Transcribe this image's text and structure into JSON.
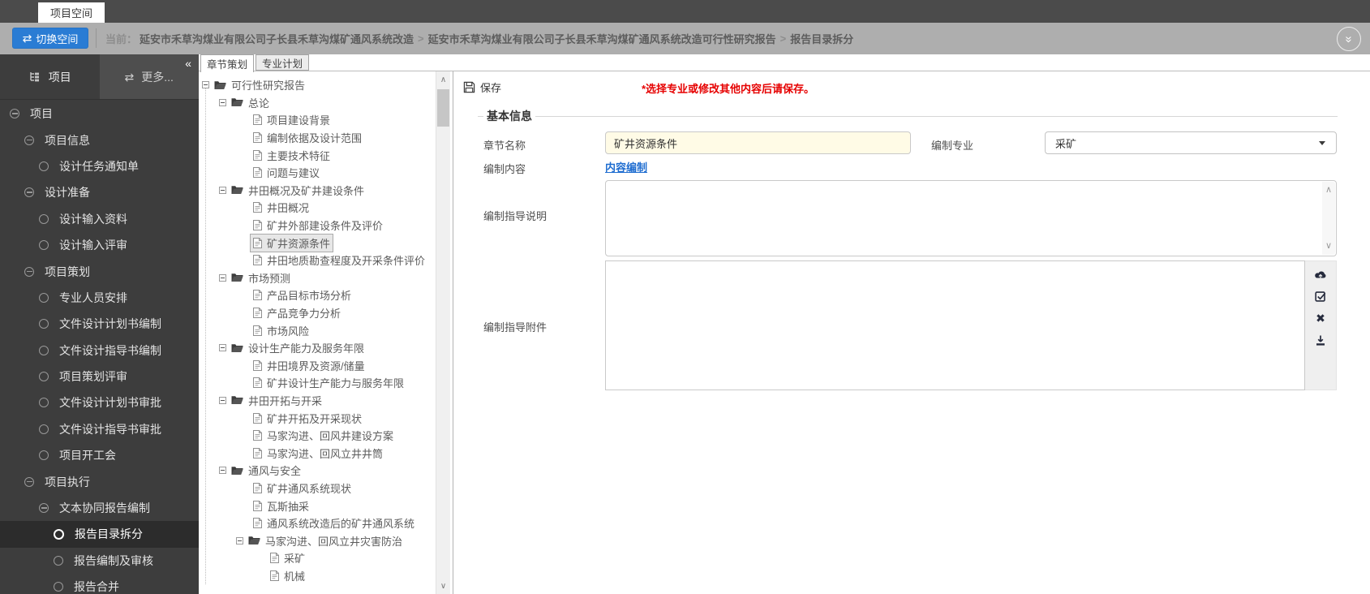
{
  "window": {
    "workspace_tab": "项目空间"
  },
  "toolbar": {
    "switch_button": "切换空间",
    "current_label": "当前：",
    "separator": ">",
    "breadcrumb": [
      "延安市禾草沟煤业有限公司子长县禾草沟煤矿通风系统改造",
      "延安市禾草沟煤业有限公司子长县禾草沟煤矿通风系统改造可行性研究报告",
      "报告目录拆分"
    ]
  },
  "sidebar": {
    "tabs": [
      {
        "label": "项目"
      },
      {
        "label": "更多..."
      }
    ],
    "tree": [
      {
        "label": "项目",
        "level": 0,
        "icon": "minus"
      },
      {
        "label": "项目信息",
        "level": 1,
        "icon": "minus"
      },
      {
        "label": "设计任务通知单",
        "level": 2,
        "icon": "circle"
      },
      {
        "label": "设计准备",
        "level": 1,
        "icon": "minus"
      },
      {
        "label": "设计输入资料",
        "level": 2,
        "icon": "circle"
      },
      {
        "label": "设计输入评审",
        "level": 2,
        "icon": "circle"
      },
      {
        "label": "项目策划",
        "level": 1,
        "icon": "minus"
      },
      {
        "label": "专业人员安排",
        "level": 2,
        "icon": "circle"
      },
      {
        "label": "文件设计计划书编制",
        "level": 2,
        "icon": "circle"
      },
      {
        "label": "文件设计指导书编制",
        "level": 2,
        "icon": "circle"
      },
      {
        "label": "项目策划评审",
        "level": 2,
        "icon": "circle"
      },
      {
        "label": "文件设计计划书审批",
        "level": 2,
        "icon": "circle"
      },
      {
        "label": "文件设计指导书审批",
        "level": 2,
        "icon": "circle"
      },
      {
        "label": "项目开工会",
        "level": 2,
        "icon": "circle"
      },
      {
        "label": "项目执行",
        "level": 1,
        "icon": "minus"
      },
      {
        "label": "文本协同报告编制",
        "level": 2,
        "icon": "minus"
      },
      {
        "label": "报告目录拆分",
        "level": 3,
        "icon": "circle",
        "selected": true
      },
      {
        "label": "报告编制及审核",
        "level": 3,
        "icon": "circle"
      },
      {
        "label": "报告合并",
        "level": 3,
        "icon": "circle"
      }
    ]
  },
  "chapter_panel": {
    "tabs": [
      {
        "label": "章节策划",
        "active": true
      },
      {
        "label": "专业计划",
        "active": false
      }
    ],
    "tree": [
      {
        "label": "可行性研究报告",
        "level": 0,
        "type": "folder"
      },
      {
        "label": "总论",
        "level": 1,
        "type": "folder"
      },
      {
        "label": "项目建设背景",
        "level": 2,
        "type": "doc"
      },
      {
        "label": "编制依据及设计范围",
        "level": 2,
        "type": "doc"
      },
      {
        "label": "主要技术特征",
        "level": 2,
        "type": "doc"
      },
      {
        "label": "问题与建议",
        "level": 2,
        "type": "doc"
      },
      {
        "label": "井田概况及矿井建设条件",
        "level": 1,
        "type": "folder"
      },
      {
        "label": "井田概况",
        "level": 2,
        "type": "doc"
      },
      {
        "label": "矿井外部建设条件及评价",
        "level": 2,
        "type": "doc"
      },
      {
        "label": "矿井资源条件",
        "level": 2,
        "type": "doc",
        "selected": true
      },
      {
        "label": "井田地质勘查程度及开采条件评价",
        "level": 2,
        "type": "doc"
      },
      {
        "label": "市场预测",
        "level": 1,
        "type": "folder"
      },
      {
        "label": "产品目标市场分析",
        "level": 2,
        "type": "doc"
      },
      {
        "label": "产品竞争力分析",
        "level": 2,
        "type": "doc"
      },
      {
        "label": "市场风险",
        "level": 2,
        "type": "doc"
      },
      {
        "label": "设计生产能力及服务年限",
        "level": 1,
        "type": "folder"
      },
      {
        "label": "井田境界及资源/储量",
        "level": 2,
        "type": "doc"
      },
      {
        "label": "矿井设计生产能力与服务年限",
        "level": 2,
        "type": "doc"
      },
      {
        "label": "井田开拓与开采",
        "level": 1,
        "type": "folder"
      },
      {
        "label": "矿井开拓及开采现状",
        "level": 2,
        "type": "doc"
      },
      {
        "label": "马家沟进、回风井建设方案",
        "level": 2,
        "type": "doc"
      },
      {
        "label": "马家沟进、回风立井井筒",
        "level": 2,
        "type": "doc"
      },
      {
        "label": "通风与安全",
        "level": 1,
        "type": "folder"
      },
      {
        "label": "矿井通风系统现状",
        "level": 2,
        "type": "doc"
      },
      {
        "label": "瓦斯抽采",
        "level": 2,
        "type": "doc"
      },
      {
        "label": "通风系统改造后的矿井通风系统",
        "level": 2,
        "type": "doc"
      },
      {
        "label": "马家沟进、回风立井灾害防治",
        "level": 2,
        "type": "folder"
      },
      {
        "label": "采矿",
        "level": 3,
        "type": "doc"
      },
      {
        "label": "机械",
        "level": 3,
        "type": "doc"
      }
    ]
  },
  "detail": {
    "save_label": "保存",
    "warning": "*选择专业或修改其他内容后请保存。",
    "section_title": "基本信息",
    "chapter_name": {
      "label": "章节名称",
      "value": "矿井资源条件"
    },
    "major": {
      "label": "编制专业",
      "value": "采矿"
    },
    "content": {
      "label": "编制内容",
      "link_text": "内容编制"
    },
    "guide_note": {
      "label": "编制指导说明",
      "value": ""
    },
    "guide_attachment": {
      "label": "编制指导附件"
    },
    "attachment_tools": [
      "upload",
      "select",
      "delete",
      "download"
    ],
    "colors": {
      "accent_blue": "#2a7cd4",
      "warning_red": "#e60000",
      "field_highlight": "#fffbe6"
    }
  }
}
